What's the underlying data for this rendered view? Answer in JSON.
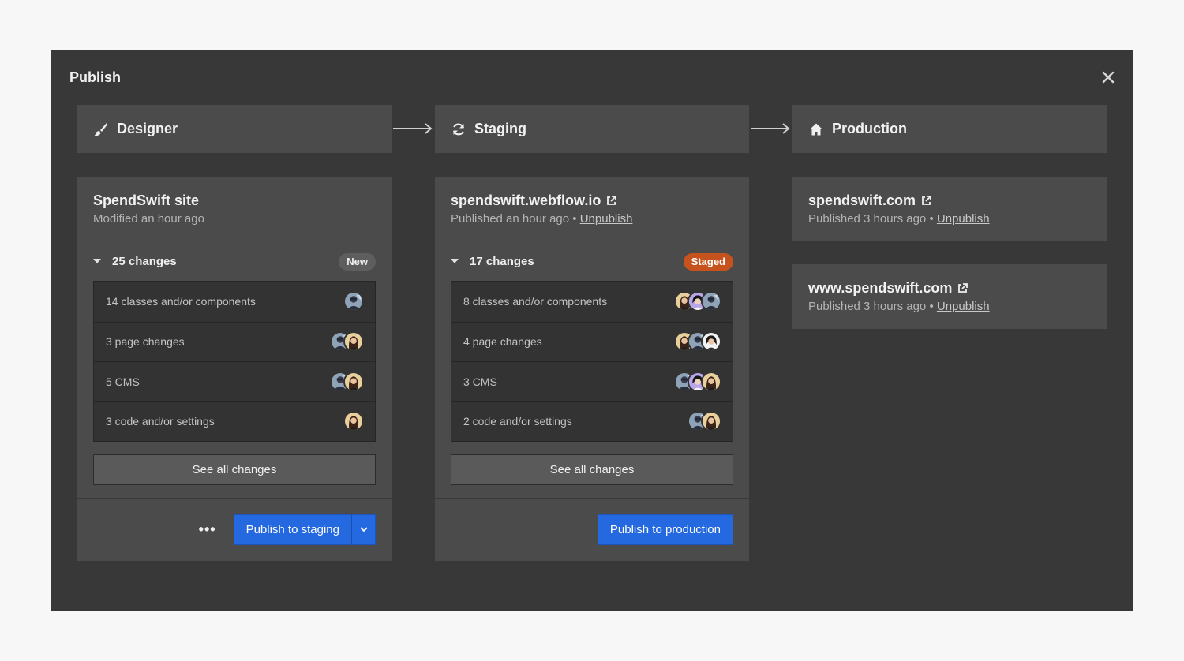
{
  "modal": {
    "title": "Publish",
    "close_icon": "close-icon"
  },
  "stages": [
    {
      "label": "Designer",
      "icon": "brush-icon"
    },
    {
      "label": "Staging",
      "icon": "refresh-icon"
    },
    {
      "label": "Production",
      "icon": "home-icon"
    }
  ],
  "designer": {
    "site_name": "SpendSwift site",
    "meta": "Modified an hour ago",
    "changes_label": "25 changes",
    "badge": "New",
    "items": [
      {
        "label": "14 classes and/or components"
      },
      {
        "label": "3 page changes"
      },
      {
        "label": "5 CMS"
      },
      {
        "label": "3 code and/or settings"
      }
    ],
    "see_all": "See all changes",
    "more": "•••",
    "publish_label": "Publish to staging"
  },
  "staging": {
    "site_name": "spendswift.webflow.io",
    "meta_prefix": "Published an hour ago •",
    "unpublish": "Unpublish",
    "changes_label": "17 changes",
    "badge": "Staged",
    "items": [
      {
        "label": "8 classes and/or components"
      },
      {
        "label": "4 page changes"
      },
      {
        "label": "3 CMS"
      },
      {
        "label": "2 code and/or settings"
      }
    ],
    "see_all": "See all changes",
    "publish_label": "Publish to production"
  },
  "production": {
    "domains": [
      {
        "name": "spendswift.com",
        "meta_prefix": "Published 3 hours ago •",
        "unpublish": "Unpublish"
      },
      {
        "name": "www.spendswift.com",
        "meta_prefix": "Published 3 hours ago •",
        "unpublish": "Unpublish"
      }
    ]
  },
  "colors": {
    "modal_bg": "#383838",
    "panel_bg": "#4b4b4b",
    "primary": "#2569e0",
    "staged_badge": "#c6531d"
  }
}
